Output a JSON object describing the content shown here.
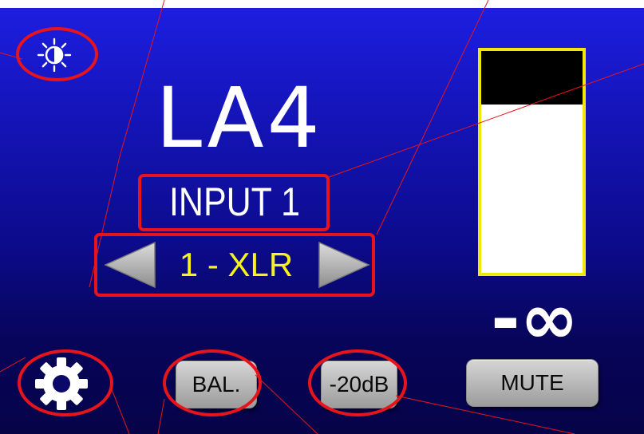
{
  "device": {
    "logo": "LA4",
    "input_label": "INPUT 1",
    "source": "1 - XLR",
    "level_readout": "-∞",
    "meter_level": 0.24
  },
  "controls": {
    "brightness_icon": "brightness-icon",
    "settings_icon": "gear-icon",
    "prev_icon": "left-arrow-icon",
    "next_icon": "right-arrow-icon",
    "bal_label": "BAL.",
    "pad_label": "-20dB",
    "mute_label": "MUTE"
  },
  "colors": {
    "background_top": "#1d1ee0",
    "background_bottom": "#060348",
    "annotation": "#e8141b",
    "meter_border": "#f2e60c",
    "source_text": "#f6f21a"
  }
}
